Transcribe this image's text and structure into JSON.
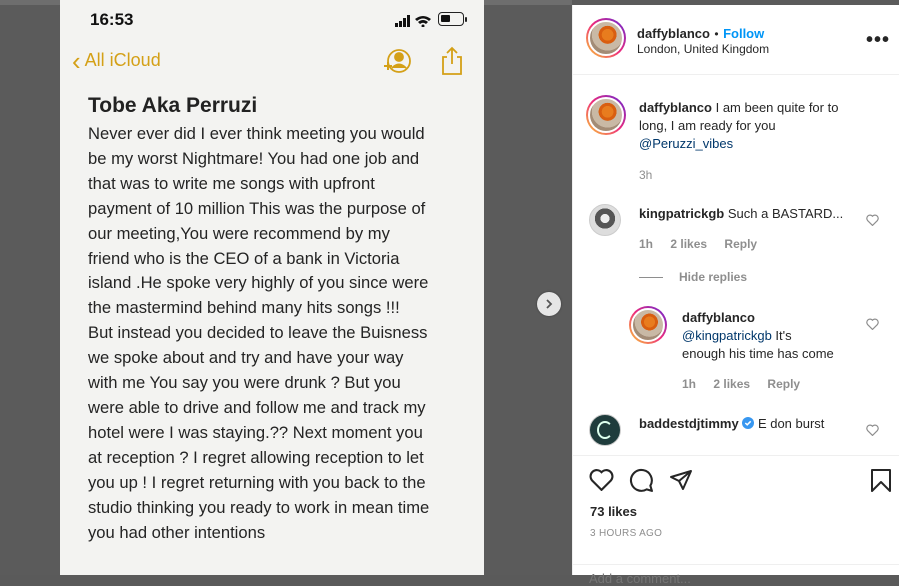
{
  "phone": {
    "time": "16:53",
    "back_label": "All iCloud",
    "note_title": "Tobe Aka Perruzi",
    "note_lines": [
      "Never ever did I ever think meeting you would",
      "be my worst Nightmare! You had one job and",
      "that was to write me songs with upfront",
      "payment of 10 million This was the purpose of",
      "our meeting,You were  recommend by my",
      "friend who is the CEO of a bank in Victoria",
      "island .He spoke very highly of you since  were",
      "the mastermind behind many hits songs !!!",
      "But instead you decided to leave the Buisness",
      "we spoke about and try and have your way",
      "with me You say you were drunk ? But you",
      "were able to drive and follow me and track my",
      "hotel were I was staying.??  Next moment you",
      "at reception ? I regret allowing reception to let",
      "you up ! I regret returning with you  back to the",
      "studio thinking you ready to work in mean time",
      "you had other intentions"
    ]
  },
  "post": {
    "author": "daffyblanco",
    "separator": "•",
    "follow_label": "Follow",
    "location": "London, United Kingdom",
    "more_label": "•••"
  },
  "caption": {
    "user": "daffyblanco",
    "text_lines": [
      "I am been quite for to",
      "long, I am ready for you"
    ],
    "mention": "@Peruzzi_vibes",
    "time": "3h"
  },
  "comments": [
    {
      "user": "kingpatrickgb",
      "text": "Such a BASTARD...",
      "time": "1h",
      "likes": "2 likes",
      "reply": "Reply"
    },
    {
      "user": "daffyblanco",
      "mention": "@kingpatrickgb",
      "text_a": " It's",
      "text_b": "enough his time has come",
      "time": "1h",
      "likes": "2 likes",
      "reply": "Reply"
    },
    {
      "user": "baddestdjtimmy",
      "text": "E don burst"
    }
  ],
  "hide_replies": "Hide replies",
  "likes_count": "73 likes",
  "posted_ago": "3 HOURS AGO",
  "add_comment_placeholder": "Add a comment...",
  "colors": {
    "accent": "#0095f6",
    "ios_yellow": "#d4a017"
  }
}
